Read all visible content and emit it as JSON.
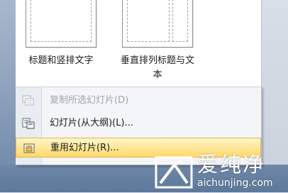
{
  "gallery": {
    "layouts": [
      {
        "label": "标题和竖排文字"
      },
      {
        "label": "垂直排列标题与文\n本"
      }
    ]
  },
  "menu": {
    "items": [
      {
        "label": "复制所选幻灯片(D)",
        "icon": "duplicate-slides-icon",
        "state": "disabled"
      },
      {
        "label": "幻灯片(从大纲)(L)...",
        "icon": "slides-from-outline-icon",
        "state": "normal"
      },
      {
        "label": "重用幻灯片(R)...",
        "icon": "reuse-slides-icon",
        "state": "hover"
      }
    ]
  },
  "watermark": {
    "title": "爱纯净",
    "url": "aichunjing.com"
  },
  "colors": {
    "hover_fill": "#ffe79a",
    "hover_border": "#e3b549",
    "disabled_text": "#a0a4aa"
  }
}
